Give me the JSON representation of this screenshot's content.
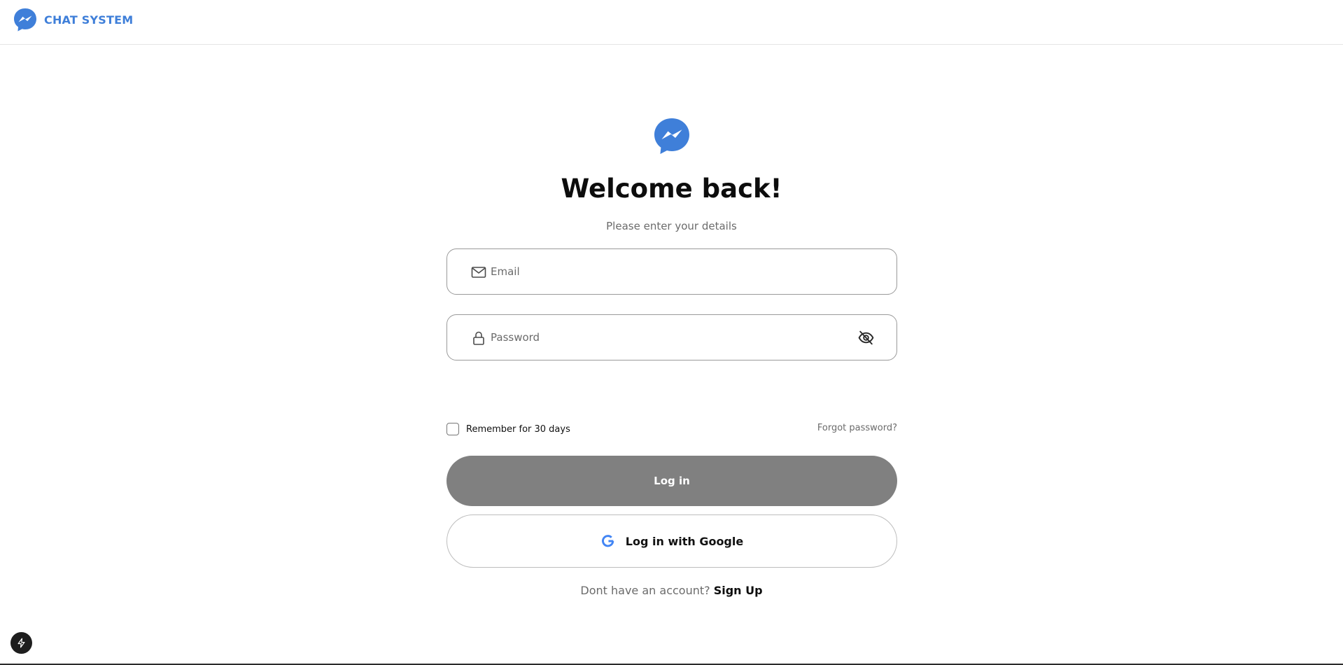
{
  "brand": {
    "name": "CHAT SYSTEM",
    "logo_icon": "messenger-logo-icon",
    "color": "#3f7fd9"
  },
  "login": {
    "logo_icon": "messenger-logo-icon",
    "title": "Welcome back!",
    "subtitle": "Please enter your details",
    "email": {
      "placeholder": "Email",
      "value": "",
      "icon": "mail-icon"
    },
    "password": {
      "placeholder": "Password",
      "value": "",
      "icon": "lock-icon",
      "toggle_icon": "eye-off-icon"
    },
    "remember_label": "Remember for 30 days",
    "remember_checked": false,
    "forgot_label": "Forgot password?",
    "login_button": "Log in",
    "google_button": "Log in with Google",
    "signup_question": "Dont have an account?",
    "signup_link": "Sign Up"
  },
  "dev_tools": {
    "icon": "lightning-bolt-icon"
  },
  "colors": {
    "accent": "#3f7fd9",
    "disabled_button": "#808080",
    "muted_text": "#6b6b6b"
  }
}
